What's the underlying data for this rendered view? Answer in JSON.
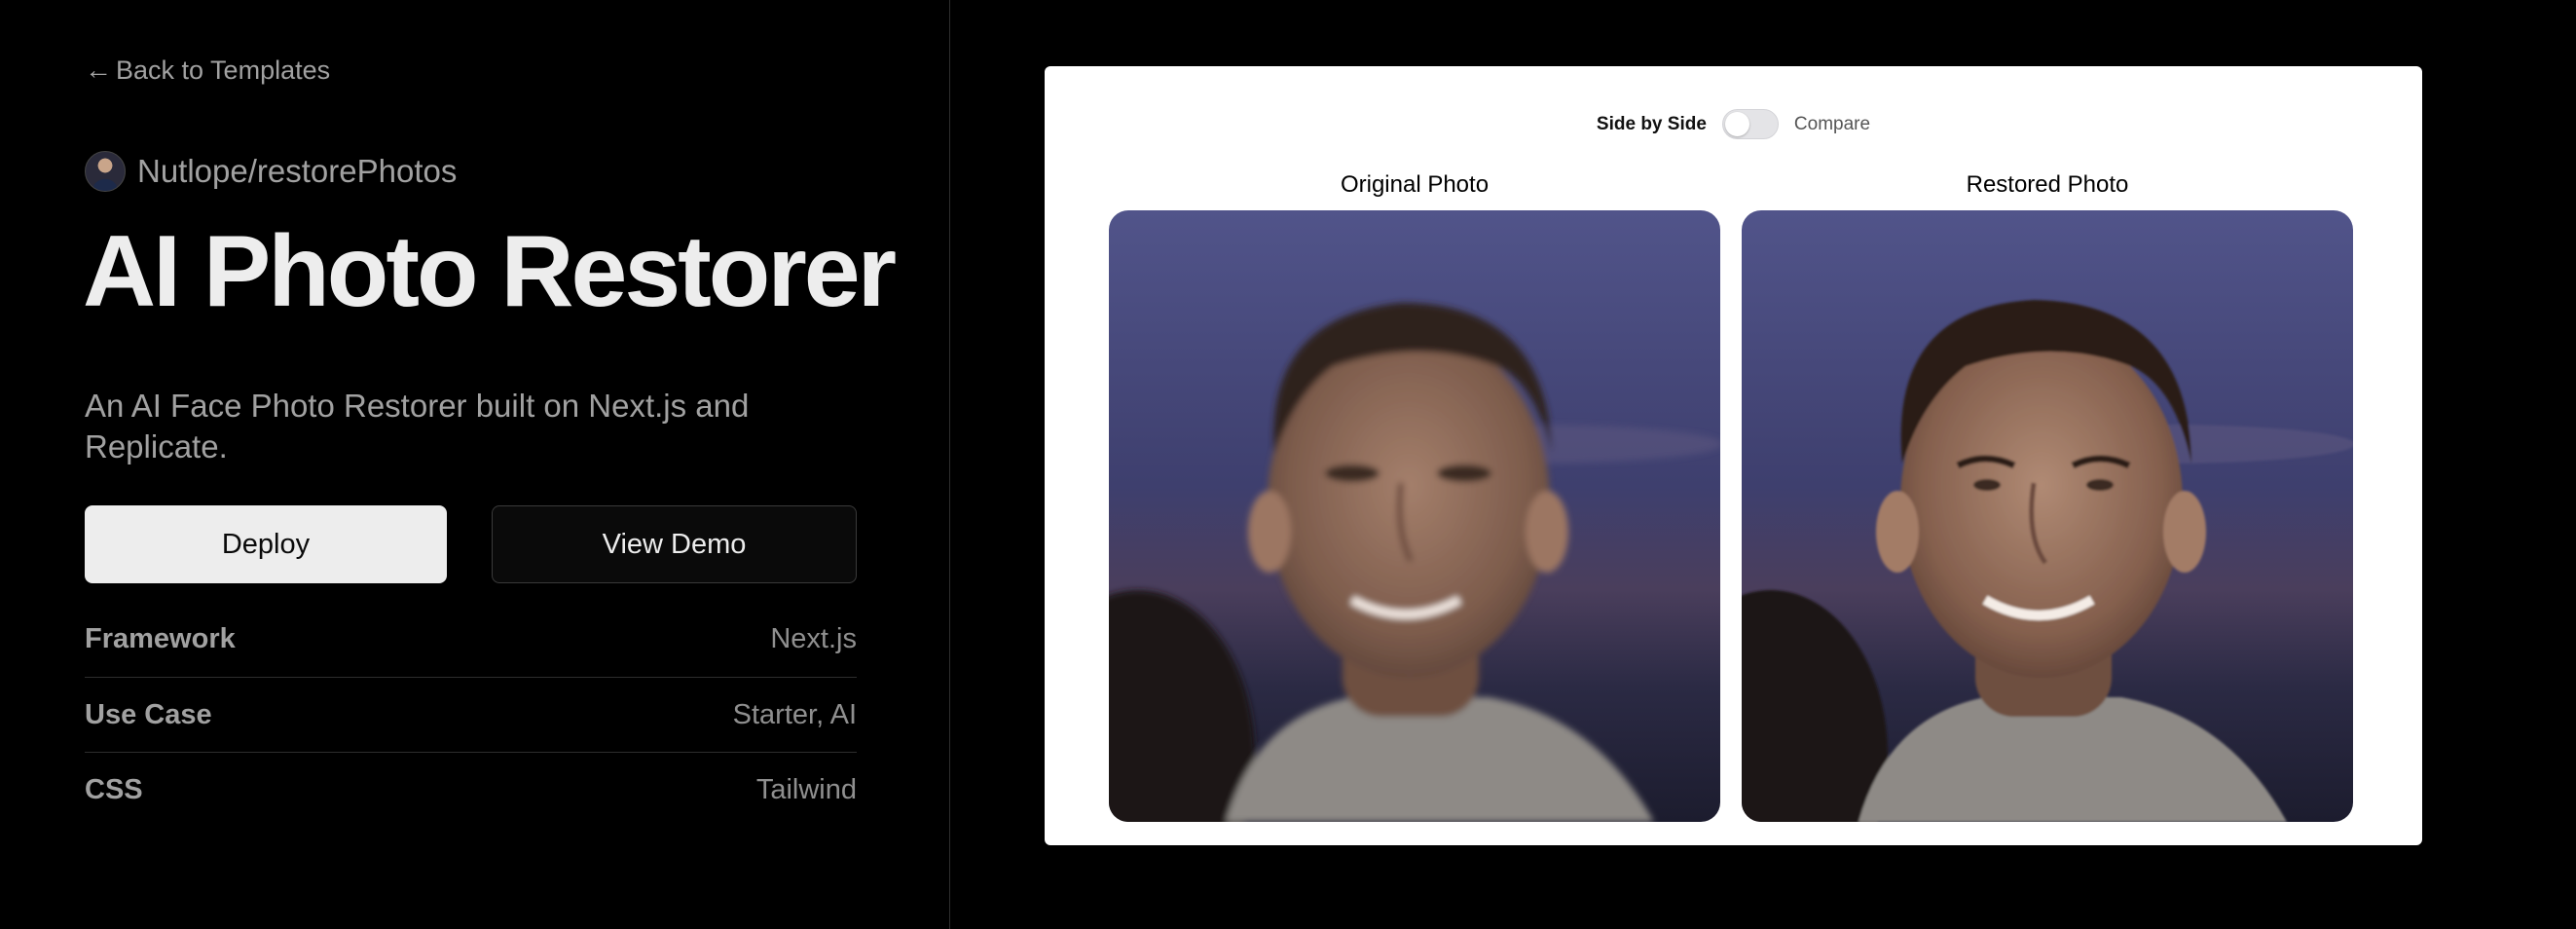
{
  "nav": {
    "back_arrow": "←",
    "back_label": "Back to Templates"
  },
  "template": {
    "author": "Nutlope/restorePhotos",
    "title": "AI Photo Restorer",
    "description": "An AI Face Photo Restorer built on Next.js and Replicate."
  },
  "actions": {
    "deploy_label": "Deploy",
    "demo_label": "View Demo"
  },
  "meta": [
    {
      "key": "Framework",
      "value": "Next.js"
    },
    {
      "key": "Use Case",
      "value": "Starter, AI"
    },
    {
      "key": "CSS",
      "value": "Tailwind"
    }
  ],
  "preview": {
    "toggle_left": "Side by Side",
    "toggle_right": "Compare",
    "original_label": "Original Photo",
    "restored_label": "Restored Photo"
  },
  "colors": {
    "background": "#000000",
    "text_primary": "#ededed",
    "text_muted": "#a1a1a1",
    "card_bg": "#ffffff"
  }
}
